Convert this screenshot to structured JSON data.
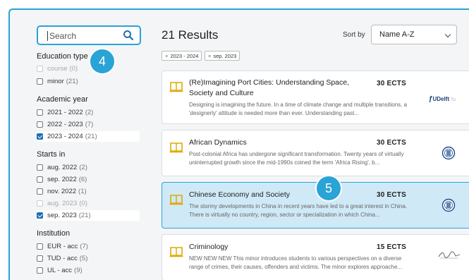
{
  "search": {
    "placeholder": "Search"
  },
  "filters": [
    {
      "title": "Education type",
      "options": [
        {
          "label": "course",
          "count": "(0)",
          "checked": false,
          "disabled": true
        },
        {
          "label": "minor",
          "count": "(21)",
          "checked": false,
          "disabled": false
        }
      ]
    },
    {
      "title": "Academic year",
      "options": [
        {
          "label": "2021 - 2022",
          "count": "(2)",
          "checked": false,
          "disabled": false
        },
        {
          "label": "2022 - 2023",
          "count": "(7)",
          "checked": false,
          "disabled": false
        },
        {
          "label": "2023 - 2024",
          "count": "(21)",
          "checked": true,
          "disabled": false
        }
      ]
    },
    {
      "title": "Starts in",
      "options": [
        {
          "label": "aug. 2022",
          "count": "(2)",
          "checked": false,
          "disabled": false
        },
        {
          "label": "sep. 2022",
          "count": "(6)",
          "checked": false,
          "disabled": false
        },
        {
          "label": "nov. 2022",
          "count": "(1)",
          "checked": false,
          "disabled": false
        },
        {
          "label": "aug. 2023",
          "count": "(0)",
          "checked": false,
          "disabled": true
        },
        {
          "label": "sep. 2023",
          "count": "(21)",
          "checked": true,
          "disabled": false
        }
      ]
    },
    {
      "title": "Institution",
      "options": [
        {
          "label": "EUR - acc",
          "count": "(7)",
          "checked": false,
          "disabled": false
        },
        {
          "label": "TUD - acc",
          "count": "(5)",
          "checked": false,
          "disabled": false
        },
        {
          "label": "UL - acc",
          "count": "(9)",
          "checked": false,
          "disabled": false
        }
      ]
    }
  ],
  "annotations": {
    "badge_a": "4",
    "badge_b": "5"
  },
  "results": {
    "title": "21 Results",
    "sort_label": "Sort by",
    "sort_value": "Name A-Z",
    "chips": [
      {
        "label": "2023 - 2024"
      },
      {
        "label": "sep. 2023"
      }
    ]
  },
  "cards": [
    {
      "title": "(Re)Imagining Port Cities: Understanding Space, Society and Culture",
      "ects": "30 ECTS",
      "desc": "Designing is imagining the future. In a time of climate change and multiple transitions, a 'designerly' attitude is needed more than ever. Understanding past...",
      "logo": "TUDelft",
      "active": false
    },
    {
      "title": "African Dynamics",
      "ects": "30 ECTS",
      "desc": "Post-colonial Africa has undergone significant transformation. Twenty years of virtually uninterrupted growth since the mid-1990s coined the term 'Africa Rising', b...",
      "logo": "seal",
      "active": false
    },
    {
      "title": "Chinese Economy and Society",
      "ects": "30 ECTS",
      "desc": "The stormy developments in China in recent years have led to a great interest in China. There is virtually no country, region, sector or specialization in which China...",
      "logo": "seal",
      "active": true
    },
    {
      "title": "Criminology",
      "ects": "15 ECTS",
      "desc": "NEW NEW NEW This minor introduces students to various perspectives on a diverse range of crimes, their causes, offenders and victims. The minor explores approache...",
      "logo": "signature",
      "active": false
    }
  ],
  "colors": {
    "accent": "#2aa3d6",
    "checkbox": "#1f6fb5",
    "active_card": "#cfe9f7",
    "book_icon": "#e0a800"
  }
}
